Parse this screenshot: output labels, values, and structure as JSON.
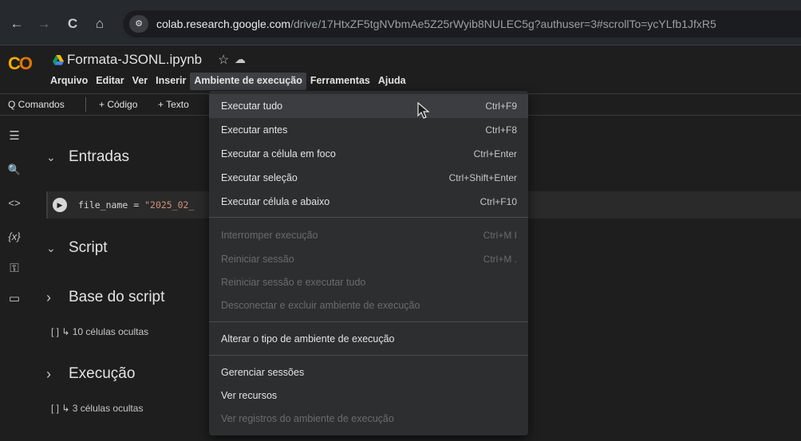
{
  "browser": {
    "back": "←",
    "forward": "→",
    "reload": "C",
    "home": "⌂",
    "site_icon": "⚙",
    "url_host": "colab.research.google.com",
    "url_rest": "/drive/17HtxZF5tgNVbmAe5Z25rWyib8NULEC5g?authuser=3#scrollTo=ycYLfb1JfxR5"
  },
  "colab": {
    "logo_c": "C",
    "logo_o": "O",
    "title": "Formata-JSONL.ipynb",
    "star": "☆",
    "cloud": "☁",
    "menu": [
      "Arquivo",
      "Editar",
      "Ver",
      "Inserir",
      "Ambiente de execução",
      "Ferramentas",
      "Ajuda"
    ]
  },
  "toolbar": {
    "commands": "Q Comandos",
    "add_code": "+ Código",
    "add_text": "+ Texto"
  },
  "rail_icons": [
    "☰",
    "🔍",
    "<>",
    "{x}",
    "⚿",
    "▭"
  ],
  "notebook": {
    "sections": [
      {
        "title": "Entradas",
        "chevron": "⌄"
      },
      {
        "title": "Script",
        "chevron": "⌄"
      },
      {
        "title": "Base do script",
        "chevron": "›"
      },
      {
        "title": "Execução",
        "chevron": "›"
      }
    ],
    "code": {
      "prefix": "file_name = ",
      "string": "\"2025_02_",
      "run": "▶"
    },
    "hidden": [
      "[ ] ↳ 10 células ocultas",
      "[ ] ↳ 3 células ocultas"
    ]
  },
  "runtime_menu": {
    "items": [
      {
        "label": "Executar tudo",
        "shortcut": "Ctrl+F9",
        "enabled": true,
        "hover": true
      },
      {
        "label": "Executar antes",
        "shortcut": "Ctrl+F8",
        "enabled": true
      },
      {
        "label": "Executar a célula em foco",
        "shortcut": "Ctrl+Enter",
        "enabled": true
      },
      {
        "label": "Executar seleção",
        "shortcut": "Ctrl+Shift+Enter",
        "enabled": true
      },
      {
        "label": "Executar célula e abaixo",
        "shortcut": "Ctrl+F10",
        "enabled": true
      },
      {
        "label": "Interromper execução",
        "shortcut": "Ctrl+M I",
        "enabled": false
      },
      {
        "label": "Reiniciar sessão",
        "shortcut": "Ctrl+M .",
        "enabled": false
      },
      {
        "label": "Reiniciar sessão e executar tudo",
        "shortcut": "",
        "enabled": false
      },
      {
        "label": "Desconectar e excluir ambiente de execução",
        "shortcut": "",
        "enabled": false
      },
      {
        "label": "Alterar o tipo de ambiente de execução",
        "shortcut": "",
        "enabled": true
      },
      {
        "label": "Gerenciar sessões",
        "shortcut": "",
        "enabled": true
      },
      {
        "label": "Ver recursos",
        "shortcut": "",
        "enabled": true
      },
      {
        "label": "Ver registros do ambiente de execução",
        "shortcut": "",
        "enabled": false
      }
    ]
  }
}
